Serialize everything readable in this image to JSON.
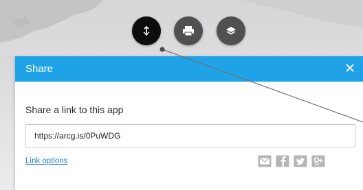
{
  "toolbar": {
    "buttons": [
      {
        "name": "share",
        "icon": "share-icon",
        "active": true
      },
      {
        "name": "print",
        "icon": "printer-icon",
        "active": false
      },
      {
        "name": "layers",
        "icon": "layers-icon",
        "active": false
      }
    ]
  },
  "share_panel": {
    "title": "Share",
    "close_icon": "close-icon",
    "heading": "Share a link to this app",
    "url": "https://arcg.is/0PuWDG",
    "link_options_label": "Link options",
    "social_icons": [
      "email-icon",
      "facebook-icon",
      "twitter-icon",
      "google-plus-icon"
    ]
  },
  "colors": {
    "header": "#1fa3e6",
    "link": "#1b7fc1",
    "active_tool": "#0d0d0d",
    "tool": "#505050",
    "social_icon": "#b5b5b5"
  }
}
